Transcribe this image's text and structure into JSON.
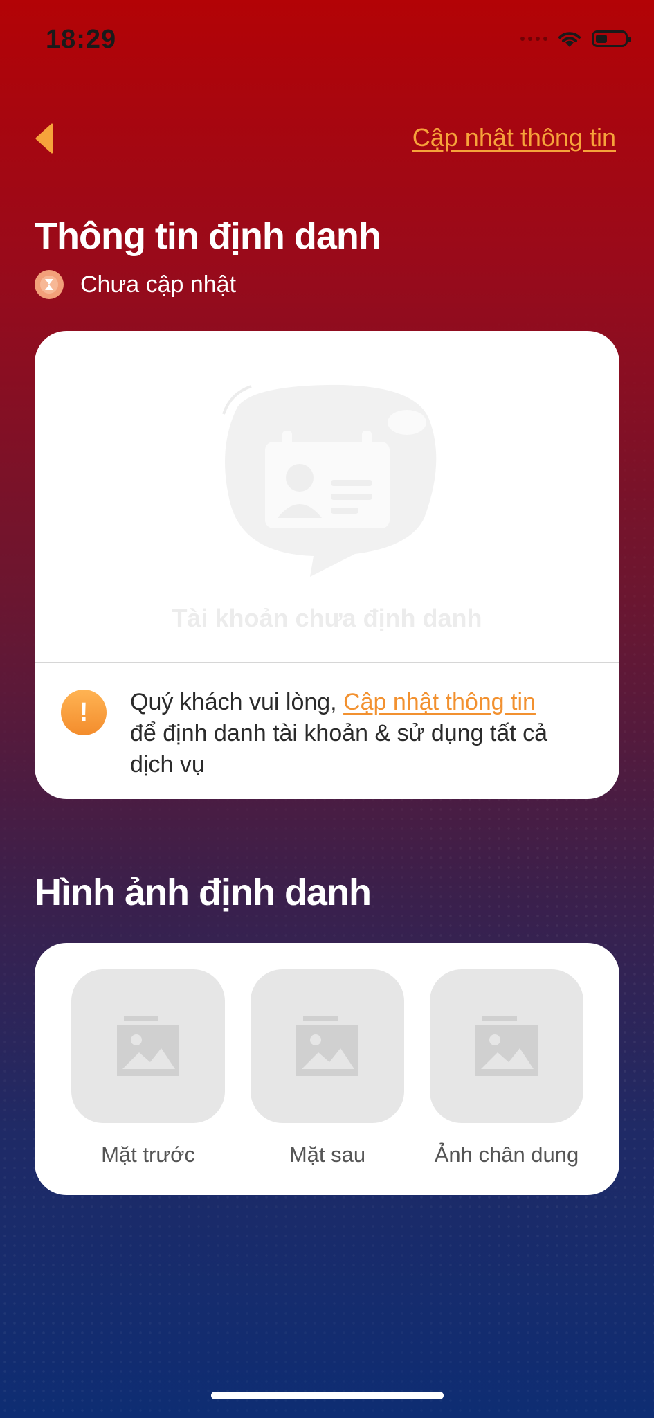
{
  "status_bar": {
    "time": "18:29",
    "battery_level": 0.4
  },
  "nav": {
    "back_icon": "chevron-left-icon",
    "update_link": "Cập nhật thông tin"
  },
  "identity": {
    "title": "Thông tin định danh",
    "status_icon": "hourglass-icon",
    "status_text": "Chưa cập nhật",
    "empty_caption": "Tài khoản chưa định danh",
    "notice_prefix": "Quý khách vui lòng, ",
    "notice_link": "Cập nhật thông tin",
    "notice_suffix": " để định danh tài khoản & sử dụng tất cả dịch vụ"
  },
  "photos": {
    "title": "Hình ảnh định danh",
    "items": [
      {
        "label": "Mặt trước",
        "icon": "image-placeholder-icon"
      },
      {
        "label": "Mặt sau",
        "icon": "image-placeholder-icon"
      },
      {
        "label": "Ảnh chân dung",
        "icon": "image-placeholder-icon"
      }
    ]
  },
  "colors": {
    "accent": "#f6a33b",
    "top": "#b30306",
    "bottom": "#0e2d73"
  }
}
